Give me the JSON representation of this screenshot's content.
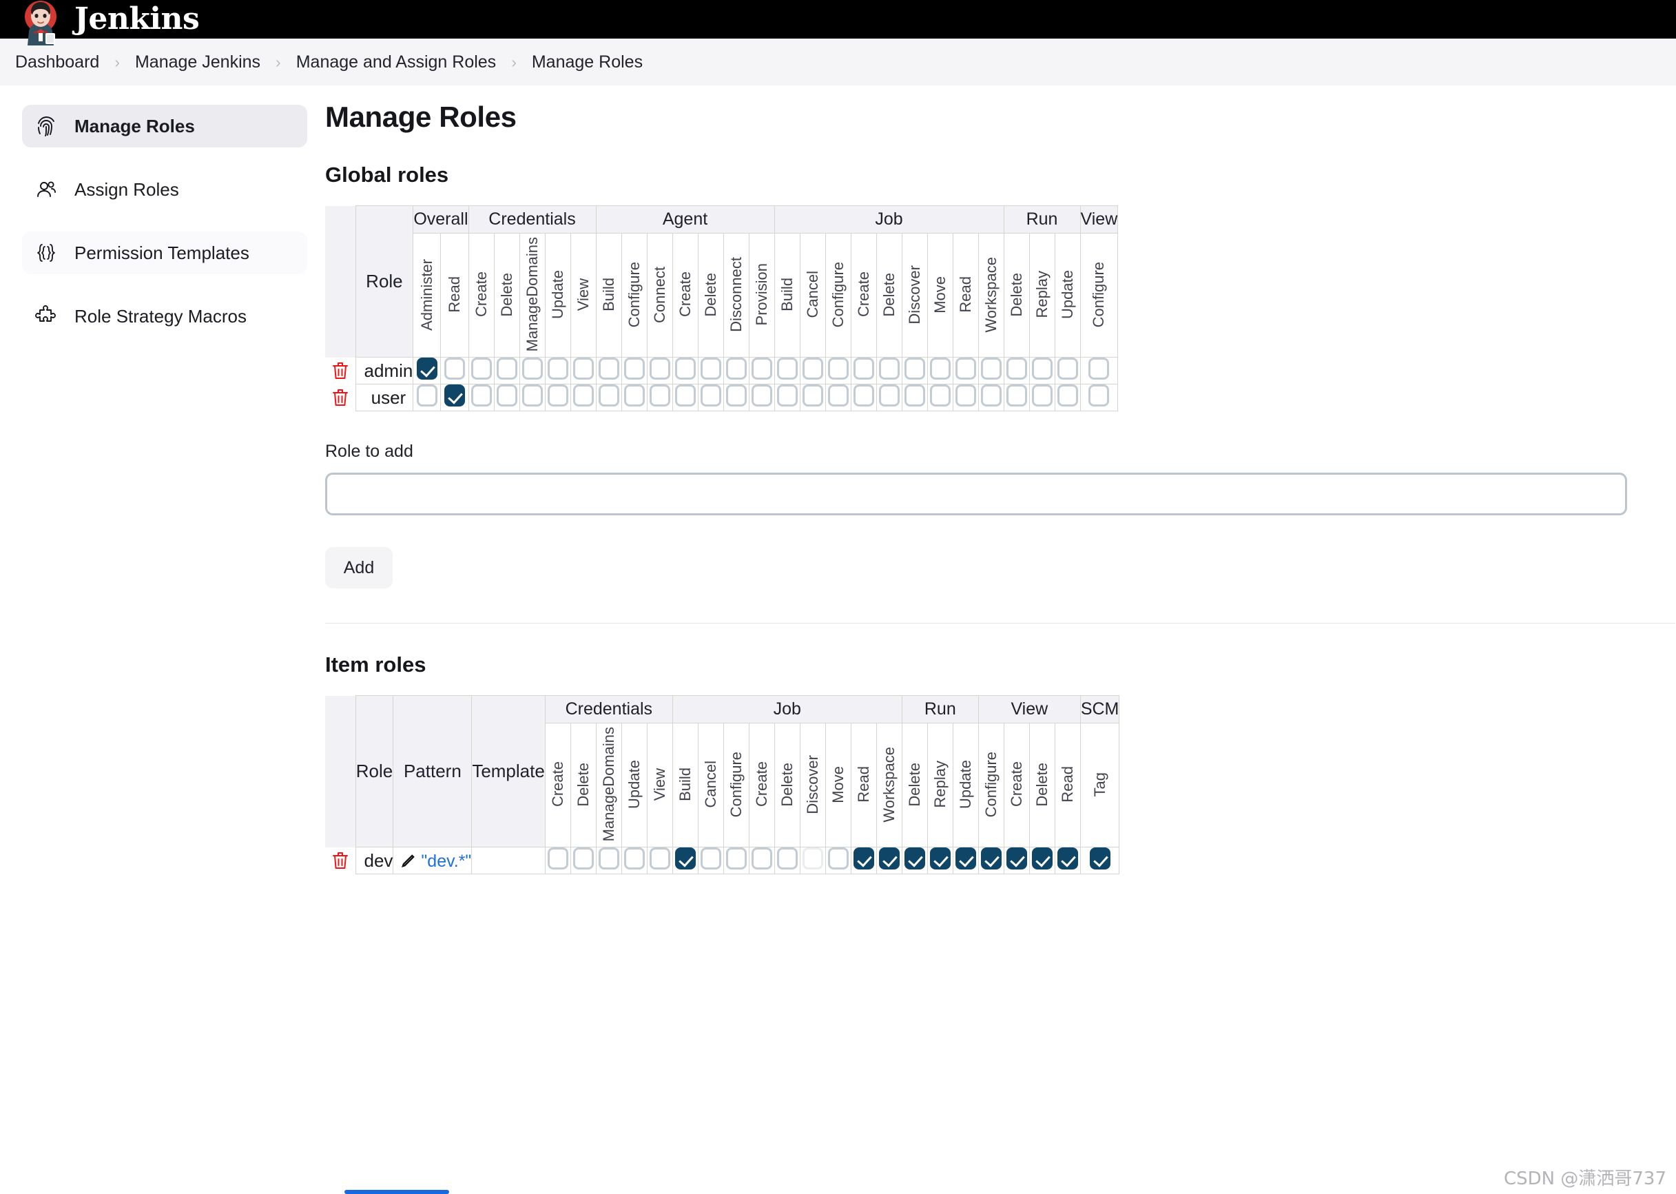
{
  "header": {
    "logo_icon": "jenkins-butler-logo",
    "wordmark": "Jenkins"
  },
  "breadcrumb": {
    "separator": "›",
    "items": [
      "Dashboard",
      "Manage Jenkins",
      "Manage and Assign Roles",
      "Manage Roles"
    ]
  },
  "sidebar": {
    "items": [
      {
        "label": "Manage Roles",
        "icon": "fingerprint-icon",
        "active": true
      },
      {
        "label": "Assign Roles",
        "icon": "people-icon",
        "active": false
      },
      {
        "label": "Permission Templates",
        "icon": "curly-braces-icon",
        "active": false
      },
      {
        "label": "Role Strategy Macros",
        "icon": "puzzle-piece-icon",
        "active": false
      }
    ]
  },
  "main": {
    "page_title": "Manage Roles",
    "global_section_title": "Global roles",
    "item_section_title": "Item roles",
    "role_to_add_label": "Role to add",
    "role_to_add_value": "",
    "role_to_add_placeholder": "",
    "add_button_label": "Add",
    "delete_icon": "trash-icon",
    "edit_icon": "pencil-icon"
  },
  "global_roles_table": {
    "corner_header": "Role",
    "groups": [
      {
        "name": "Overall",
        "columns": [
          "Administer",
          "Read"
        ]
      },
      {
        "name": "Credentials",
        "columns": [
          "Create",
          "Delete",
          "ManageDomains",
          "Update",
          "View"
        ]
      },
      {
        "name": "Agent",
        "columns": [
          "Build",
          "Configure",
          "Connect",
          "Create",
          "Delete",
          "Disconnect",
          "Provision"
        ]
      },
      {
        "name": "Job",
        "columns": [
          "Build",
          "Cancel",
          "Configure",
          "Create",
          "Delete",
          "Discover",
          "Move",
          "Read",
          "Workspace"
        ]
      },
      {
        "name": "Run",
        "columns": [
          "Delete",
          "Replay",
          "Update"
        ]
      },
      {
        "name": "View",
        "columns": [
          "Configure"
        ]
      }
    ],
    "rows": [
      {
        "role": "admin",
        "checked": [
          true,
          false,
          false,
          false,
          false,
          false,
          false,
          false,
          false,
          false,
          false,
          false,
          false,
          false,
          false,
          false,
          false,
          false,
          false,
          false,
          false,
          false,
          false,
          false,
          false,
          false,
          false
        ]
      },
      {
        "role": "user",
        "checked": [
          false,
          true,
          false,
          false,
          false,
          false,
          false,
          false,
          false,
          false,
          false,
          false,
          false,
          false,
          false,
          false,
          false,
          false,
          false,
          false,
          false,
          false,
          false,
          false,
          false,
          false,
          false
        ]
      }
    ]
  },
  "item_roles_table": {
    "corner_headers": [
      "Role",
      "Pattern",
      "Template"
    ],
    "groups": [
      {
        "name": "Credentials",
        "columns": [
          "Create",
          "Delete",
          "ManageDomains",
          "Update",
          "View"
        ]
      },
      {
        "name": "Job",
        "columns": [
          "Build",
          "Cancel",
          "Configure",
          "Create",
          "Delete",
          "Discover",
          "Move",
          "Read",
          "Workspace"
        ]
      },
      {
        "name": "Run",
        "columns": [
          "Delete",
          "Replay",
          "Update"
        ]
      },
      {
        "name": "View",
        "columns": [
          "Configure",
          "Create",
          "Delete",
          "Read"
        ]
      },
      {
        "name": "SCM",
        "columns": [
          "Tag"
        ]
      }
    ],
    "rows": [
      {
        "role": "dev",
        "pattern": "\"dev.*\"",
        "template": "",
        "checked": [
          false,
          false,
          false,
          false,
          false,
          true,
          false,
          false,
          false,
          false,
          false,
          false,
          true,
          true,
          true,
          true,
          true,
          true,
          true,
          true,
          true,
          true
        ],
        "disabled": [
          false,
          false,
          false,
          false,
          false,
          false,
          false,
          false,
          false,
          false,
          true,
          false,
          false,
          false,
          false,
          false,
          false,
          false,
          false,
          false,
          false,
          false
        ]
      }
    ]
  },
  "watermark": "CSDN @潇洒哥737"
}
